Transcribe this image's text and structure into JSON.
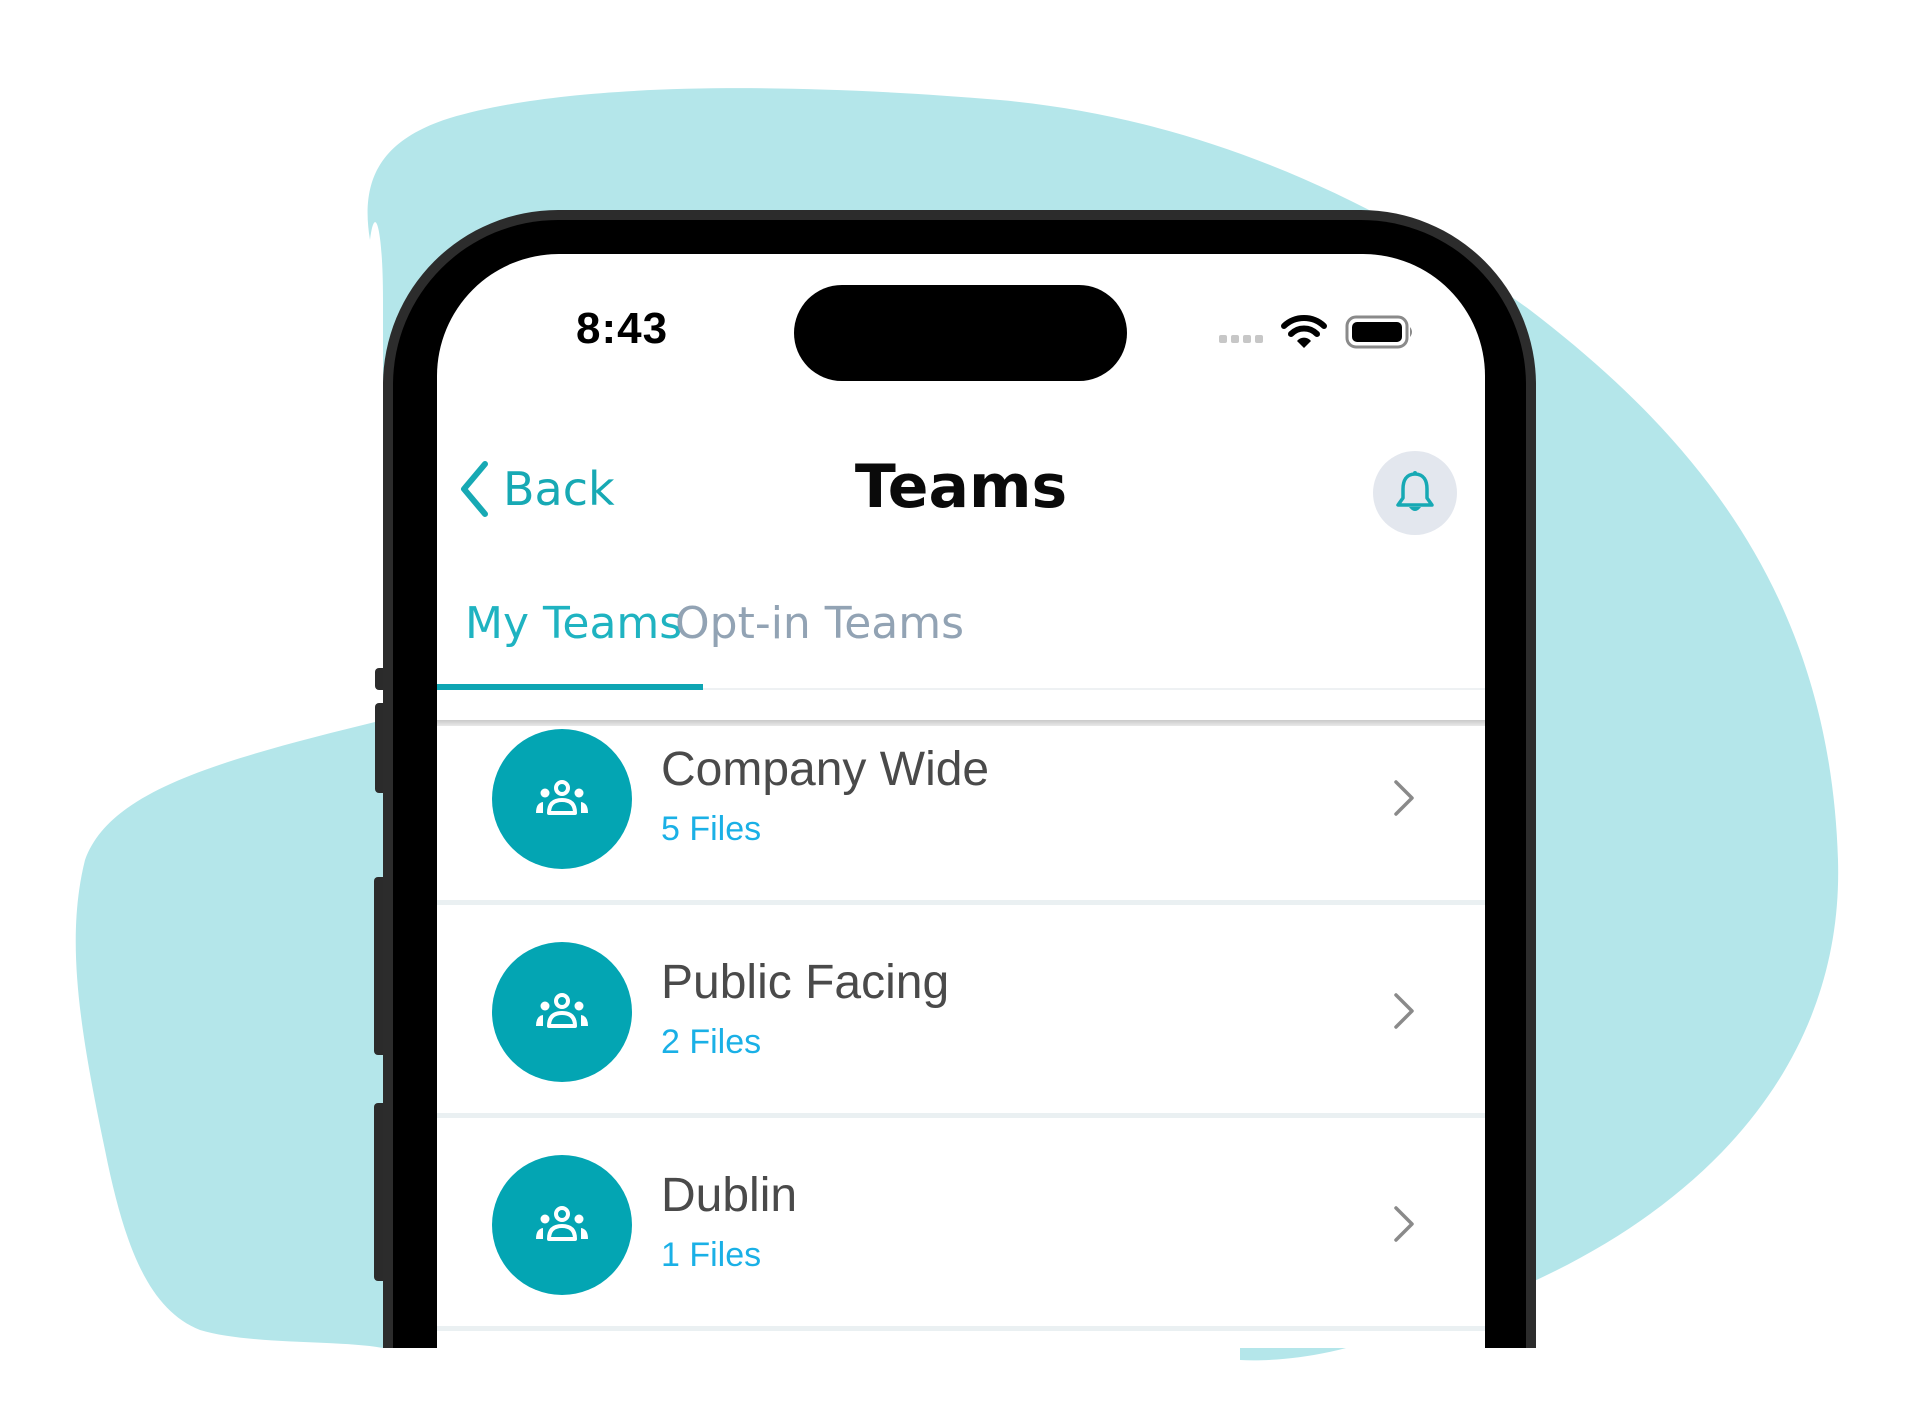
{
  "status_bar": {
    "time": "8:43",
    "icons": [
      "signal-dots-icon",
      "wifi-icon",
      "battery-icon"
    ]
  },
  "nav": {
    "back_label": "Back",
    "title": "Teams",
    "notification_icon": "bell-icon"
  },
  "tabs": [
    {
      "label": "My Teams",
      "active": true
    },
    {
      "label": "Opt-in Teams",
      "active": false
    }
  ],
  "teams": [
    {
      "name": "Company Wide",
      "files": "5 Files",
      "icon": "team-group-icon"
    },
    {
      "name": "Public Facing",
      "files": "2 Files",
      "icon": "team-group-icon"
    },
    {
      "name": "Dublin",
      "files": "1 Files",
      "icon": "team-group-icon"
    }
  ],
  "colors": {
    "accent": "#0ea5b3",
    "avatar": "#03a5b3",
    "file_count": "#1ab0e6",
    "tab_inactive": "#92a3b4",
    "background_blob": "#b4e6ea"
  }
}
